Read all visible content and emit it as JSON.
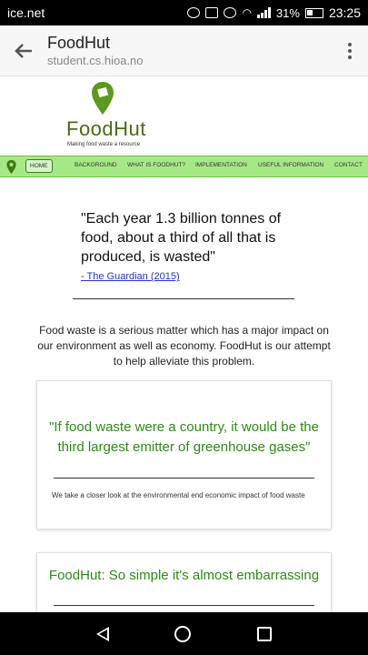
{
  "status_bar": {
    "carrier": "ice.net",
    "battery": "31%",
    "time": "23:25"
  },
  "browser": {
    "title": "FoodHut",
    "url": "student.cs.hioa.no"
  },
  "logo": {
    "name": "FoodHut",
    "tagline": "Making food waste a resource"
  },
  "nav": {
    "items": [
      "HOME",
      "BACKGROUND",
      "WHAT IS FOODHUT?",
      "IMPLEMENTATION",
      "USEFUL INFORMATION",
      "CONTACT"
    ]
  },
  "hero": {
    "quote": "\"Each year 1.3 billion tonnes of food, about a third of all that is produced, is wasted\"",
    "source": "- The Guardian (2015)"
  },
  "intro": "Food waste is a serious matter which has a major impact on our environment as well as economy. FoodHut is our attempt to help alleviate this problem.",
  "cards": [
    {
      "title": "\"If food waste were a country, it would be the third largest emitter of greenhouse gases\"",
      "body": "We take a closer look at the environmental end economic impact of food waste"
    },
    {
      "title": "FoodHut: So simple it's almost embarrassing",
      "body": ""
    }
  ],
  "colors": {
    "brand_green": "#2e8a16",
    "nav_green": "#a7e886",
    "logo_green": "#4a6a1a"
  }
}
